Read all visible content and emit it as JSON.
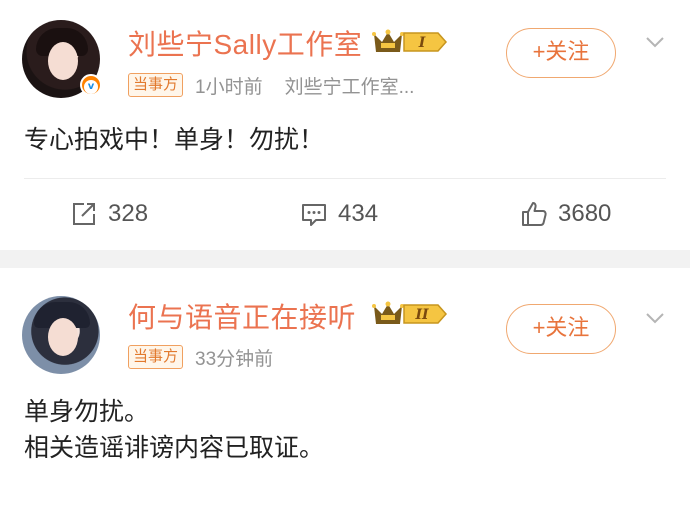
{
  "posts": [
    {
      "author": "刘些宁Sally工作室",
      "level": "I",
      "tag": "当事方",
      "time": "1小时前",
      "source": "刘些宁工作室...",
      "follow_label": "+关注",
      "verified": true,
      "content_lines": [
        "专心拍戏中！单身！勿扰！"
      ],
      "reposts": "328",
      "comments": "434",
      "likes": "3680"
    },
    {
      "author": "何与语音正在接听",
      "level": "II",
      "tag": "当事方",
      "time": "33分钟前",
      "follow_label": "+关注",
      "content_lines": [
        "单身勿扰。",
        "相关造谣诽谤内容已取证。"
      ]
    }
  ],
  "colors": {
    "name": "#eb7350",
    "accent": "#e8743c",
    "badge_border": "#f0a060",
    "meta": "#939393",
    "background": "#f2f2f2"
  },
  "icons": [
    "repost-icon",
    "comment-icon",
    "like-icon",
    "crown-icon",
    "chevron-down-icon",
    "verified-icon"
  ]
}
